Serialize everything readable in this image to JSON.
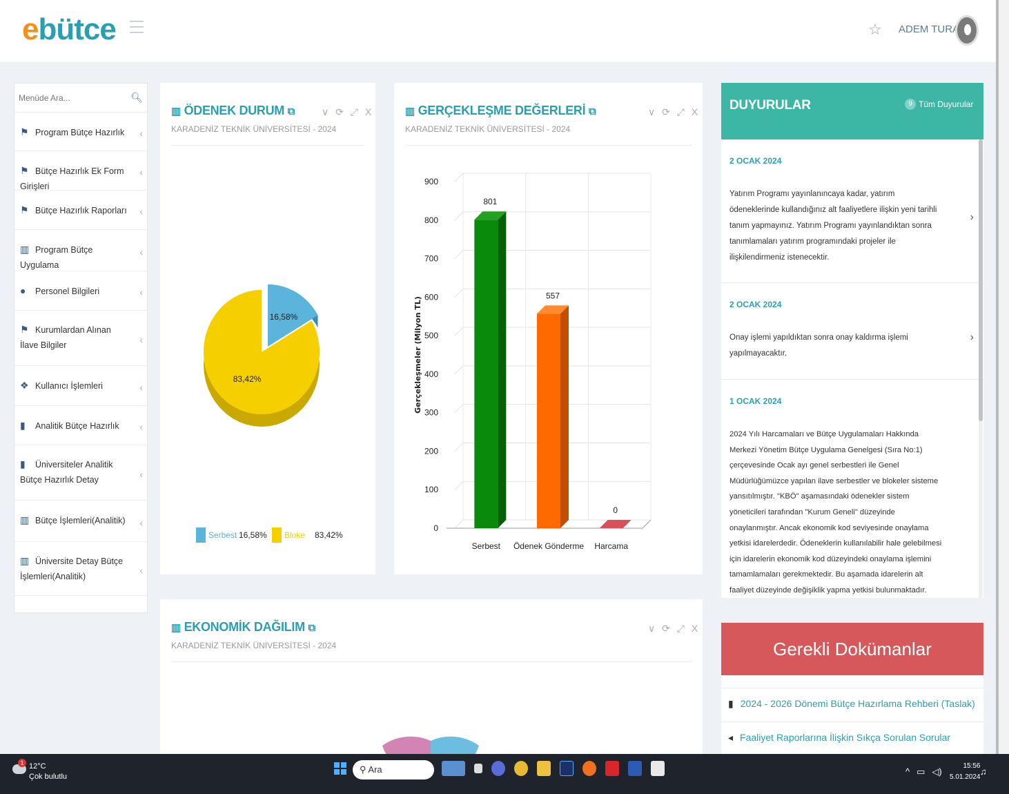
{
  "app": {
    "logo_left": "e",
    "logo_right": "bütce",
    "user": "ADEM TURAN"
  },
  "sidebar": {
    "search_placeholder": "Menüde Ara...",
    "items": [
      {
        "label": "Program Bütçe Hazırlık",
        "icon": "flag-icon"
      },
      {
        "label": "Bütçe Hazırlık Ek Form Girişleri",
        "icon": "flag-icon"
      },
      {
        "label": "Bütçe Hazırlık Raporları",
        "icon": "flag-icon"
      },
      {
        "label": "Program Bütçe Uygulama",
        "icon": "bar-chart-icon"
      },
      {
        "label": "Personel Bilgileri",
        "icon": "user-icon"
      },
      {
        "label": "Kurumlardan Alınan İlave Bilgiler",
        "icon": "flag-icon"
      },
      {
        "label": "Kullanıcı İşlemleri",
        "icon": "users-icon"
      },
      {
        "label": "Analitik Bütçe Hazırlık",
        "icon": "book-icon"
      },
      {
        "label": "Üniversiteler Analitik Bütçe Hazırlık Detay",
        "icon": "book-icon"
      },
      {
        "label": "Bütçe İşlemleri(Analitik)",
        "icon": "bar-chart-icon"
      },
      {
        "label": "Üniversite Detay Bütçe İşlemleri(Analitik)",
        "icon": "bar-chart-icon"
      }
    ]
  },
  "odenek": {
    "title": "ÖDENEK DURUM",
    "subtitle": "KARADENİZ TEKNİK ÜNİVERSİTESİ - 2024",
    "controls": "∨ ⟳ ⤢ X"
  },
  "gerceklesme": {
    "title": "GERÇEKLEŞME DEĞERLERİ",
    "subtitle": "KARADENİZ TEKNİK ÜNİVERSİTESİ - 2024",
    "controls": "∨ ⟳ ⤢ X"
  },
  "ekonomik": {
    "title": "EKONOMİK DAĞILIM",
    "subtitle": "KARADENİZ TEKNİK ÜNİVERSİTESİ - 2024",
    "controls": "∨ ⟳ ⤢ X"
  },
  "duyurular": {
    "title": "DUYURULAR",
    "count": "9",
    "all_label": "Tüm Duyurular",
    "items": [
      {
        "date": "2 OCAK 2024",
        "text": "Yatırım Programı yayınlanıncaya kadar, yatırım ödeneklerinde kullandığınız alt faaliyetlere ilişkin yeni tarihli tanım yapmayınız. Yatırım Programı yayınlandıktan sonra tanımlamaları yatırım programındaki projeler ile ilişkilendirmeniz istenecektir."
      },
      {
        "date": "2 OCAK 2024",
        "text": "Onay işlemi yapıldıktan sonra onay kaldırma işlemi yapılmayacaktır."
      },
      {
        "date": "1 OCAK 2024",
        "text": "2024 Yılı Harcamaları ve Bütçe Uygulamaları Hakkında Merkezi Yönetim Bütçe Uygulama Genelgesi (Sıra No:1) çerçevesinde Ocak ayı genel serbestleri ile Genel Müdürlüğümüzce yapılan ilave serbestler ve blokeler sisteme yansıtılmıştır. \"KBÖ\" aşamasındaki ödenekler sistem yöneticileri tarafından \"Kurum Geneli\" düzeyinde onaylanmıştır. Ancak ekonomik kod seviyesinde onaylama yetkisi idarelerdedir. Ödeneklerin kullanılabilir hale gelebilmesi için idarelerin ekonomik kod düzeyindeki onaylama işlemini tamamlamaları gerekmektedir.  Bu aşamada idarelerin alt faaliyet düzeyinde değişiklik yapma yetkisi bulunmaktadır. Program - Alt Program - Faaliyet - KurumKod - FinKod - Ekokod düzeyinde değişiklik yapılamayacaktır. KBÖ aşamasındaki"
      }
    ]
  },
  "docs": {
    "title": "Gerekli Dokümanlar",
    "items": [
      {
        "label": "2024 - 2026 Dönemi Bütçe Hazırlama Rehberi (Taslak)",
        "icon": "book-icon"
      },
      {
        "label": "Faaliyet Raporlarına İlişkin Sıkça Sorulan Sorular",
        "icon": "megaphone-icon"
      }
    ]
  },
  "taskbar": {
    "temp": "12°C",
    "weather": "Çok bulutlu",
    "weather_badge": "1",
    "search": "Ara",
    "time": "15:56",
    "date": "5.01.2024"
  },
  "colors": {
    "teal": "#2a9fb1",
    "serbest": "#5ab4dc",
    "bloke": "#f5cf00",
    "bar_green": "#0a8a0a",
    "bar_orange": "#ff6a00",
    "bar_red": "#c2303a",
    "red_header": "#d6585a"
  },
  "chart_data": [
    {
      "type": "pie",
      "title": "ÖDENEK DURUM",
      "labels": [
        "Serbest",
        "Bloke"
      ],
      "values": [
        16.58,
        83.42
      ],
      "data_labels": [
        "16,58%",
        "83,42%"
      ],
      "legend": [
        {
          "name": "Serbest",
          "value": "16,58%"
        },
        {
          "name": "Bloke",
          "value": "83,42%"
        }
      ]
    },
    {
      "type": "bar",
      "title": "GERÇEKLEŞME DEĞERLERİ",
      "categories": [
        "Serbest",
        "Ödenek Gönderme",
        "Harcama"
      ],
      "values": [
        801,
        557,
        0
      ],
      "ylabel": "Gerçekleşmeler (Milyon TL)",
      "ylim": [
        0,
        900
      ],
      "yticks": [
        0,
        100,
        200,
        300,
        400,
        500,
        600,
        700,
        800,
        900
      ],
      "grid": true
    }
  ]
}
